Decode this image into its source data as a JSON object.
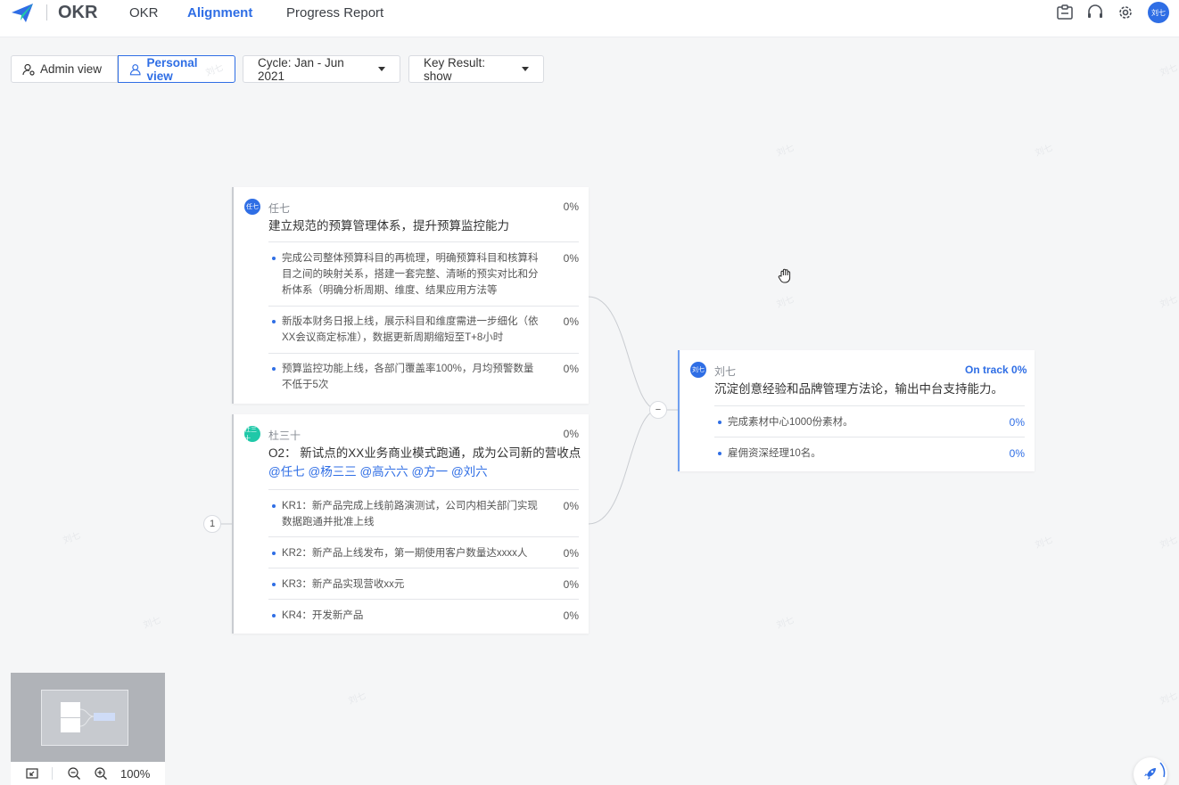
{
  "app": {
    "name": "OKR"
  },
  "nav": {
    "items": [
      "OKR",
      "Alignment",
      "Progress Report"
    ]
  },
  "header_icons": [
    "clipboard-icon",
    "headset-icon",
    "gear-icon"
  ],
  "user": {
    "avatar_text": "刘七"
  },
  "toolbar": {
    "admin_view": "Admin view",
    "personal_view": "Personal view",
    "cycle": "Cycle: Jan - Jun 2021",
    "key_result": "Key Result: show"
  },
  "watermark": "刘七",
  "cards": {
    "c1": {
      "avatar": "任七",
      "owner": "任七",
      "title": "建立规范的预算管理体系，提升预算监控能力",
      "percent": "0%",
      "krs": [
        {
          "text": "完成公司整体预算科目的再梳理，明确预算科目和核算科目之间的映射关系，搭建一套完整、清晰的预实对比和分析体系（明确分析周期、维度、结果应用方法等",
          "percent": "0%"
        },
        {
          "text": "新版本财务日报上线，展示科目和维度需进一步细化（依XX会议商定标准），数据更新周期缩短至T+8小时",
          "percent": "0%"
        },
        {
          "text": "预算监控功能上线，各部门覆盖率100%，月均预警数量不低于5次",
          "percent": "0%"
        }
      ]
    },
    "c2": {
      "avatar": "杜三十",
      "owner": "杜三十",
      "title_prefix": "O2： 新试点的XX业务商业模式跑通，成为公司新的营收点",
      "mentions": [
        "@任七",
        "@杨三三",
        "@高六六",
        "@方一",
        "@刘六"
      ],
      "percent": "0%",
      "krs": [
        {
          "text": "KR1：新产品完成上线前路演测试，公司内相关部门实现数据跑通并批准上线",
          "percent": "0%"
        },
        {
          "text": "KR2：新产品上线发布，第一期使用客户数量达xxxx人",
          "percent": "0%"
        },
        {
          "text": "KR3：新产品实现营收xx元",
          "percent": "0%"
        },
        {
          "text": "KR4：开发新产品",
          "percent": "0%"
        }
      ]
    },
    "c3": {
      "avatar": "刘七",
      "owner": "刘七",
      "title": "沉淀创意经验和品牌管理方法论，输出中台支持能力。",
      "status": "On track 0%",
      "krs": [
        {
          "text": "完成素材中心1000份素材。",
          "percent": "0%"
        },
        {
          "text": "雇佣资深经理10名。",
          "percent": "0%"
        }
      ]
    }
  },
  "nodes": {
    "collapse": "−",
    "expand_count": "1"
  },
  "zoom": {
    "level": "100%"
  },
  "colors": {
    "accent": "#2f6ee5",
    "teal": "#1fc8a8"
  }
}
